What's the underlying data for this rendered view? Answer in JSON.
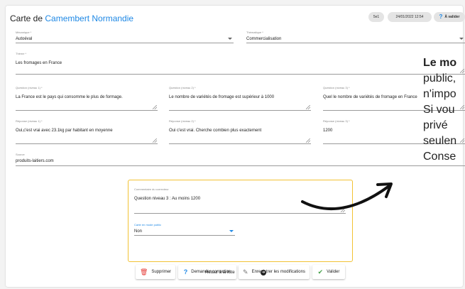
{
  "header": {
    "title_prefix": "Carte de ",
    "title_accent": "Camembert Normandie",
    "badge_count": "5e1",
    "badge_date": "24/01/2022 12:54",
    "badge_status": "À valider",
    "status_icon": "question-icon"
  },
  "fields": {
    "mecanique": {
      "label": "Mécanique *",
      "value": "Autoéval"
    },
    "thematique": {
      "label": "Thématique *",
      "value": "Commercialisation"
    },
    "theme": {
      "label": "Thème *",
      "value": "Les fromages en France"
    },
    "q1": {
      "label": "Question (niveau 1) *",
      "value": "La France est le pays qui consomme le plus de formage."
    },
    "q2": {
      "label": "Question (niveau 2) *",
      "value": "Le nombre de variétés de fromage est supérieur à 1000"
    },
    "q3": {
      "label": "Question (niveau 3) *",
      "value": "Quel le nombre de variétés de fromage en France"
    },
    "r1": {
      "label": "Réponse (niveau 1) *",
      "value": "Oui,c'est vrai avec 23.1kg par habitant en moyenne"
    },
    "r2": {
      "label": "Réponse (niveau 2) *",
      "value": "Oui c'est vrai. Cherche combien plus exactement"
    },
    "r3": {
      "label": "Réponse (niveau 3) *",
      "value": "1200"
    },
    "source": {
      "label": "Source",
      "value": "produits-laitiers.com"
    }
  },
  "review": {
    "comment_label": "Commentaire du correcteur",
    "comment_value": "Question niveau 3 : Au moins 1200",
    "public_label": "Carte en mode public",
    "public_value": "Non"
  },
  "actions": {
    "delete": {
      "label": "Supprimer",
      "icon": "trash-icon",
      "color": "#e53935"
    },
    "request": {
      "label": "Demander correction",
      "icon": "question-icon",
      "color": "#1e88e5"
    },
    "save": {
      "label": "Enregistrer les modifications",
      "icon": "pencil-icon",
      "color": "#777777"
    },
    "validate": {
      "label": "Valider",
      "icon": "check-icon",
      "color": "#43a047"
    }
  },
  "footer": {
    "back_label": "Retour à la liste",
    "back_icon": "arrow-right-circle-icon"
  },
  "overlay": {
    "line1": "Le mo",
    "line2": "public,",
    "line3": "n'impo",
    "line4": "Si vou",
    "line5": "privé",
    "line6": "seulen",
    "line7": "Conse"
  },
  "colors": {
    "accent": "#1e88e5",
    "panel_border": "#f2c233",
    "badge_bg": "#e4e4e4"
  }
}
